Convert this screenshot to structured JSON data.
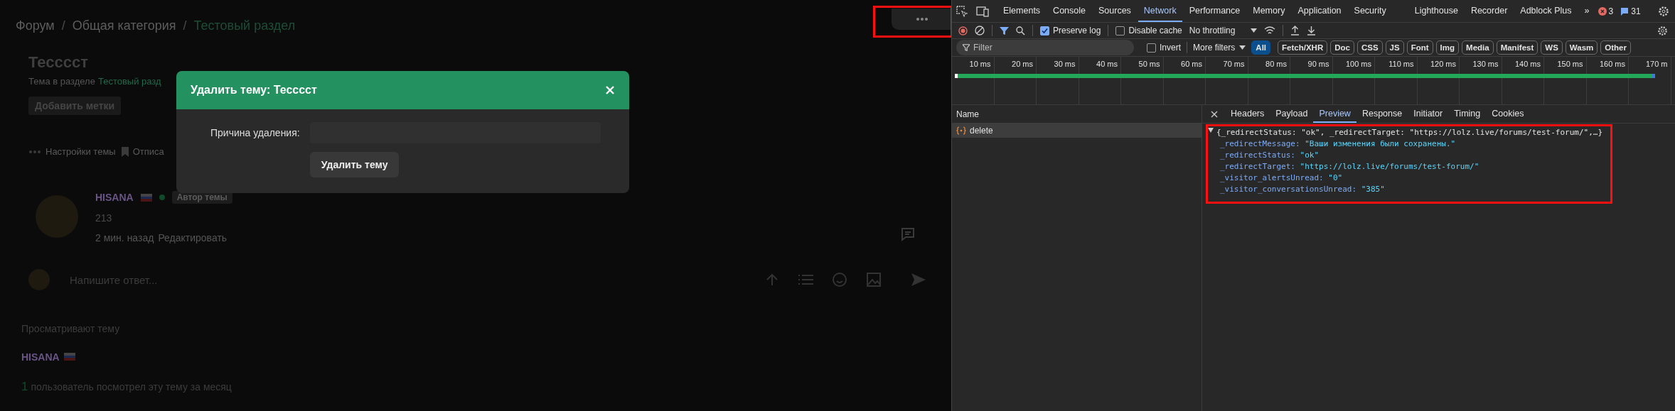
{
  "forum": {
    "breadcrumb_separator": "/",
    "breadcrumb": [
      {
        "label": "Форум",
        "current": false
      },
      {
        "label": "Общая категория",
        "current": false
      },
      {
        "label": "Тестовый раздел",
        "current": true
      }
    ],
    "thread_title": "Тесссст",
    "thread_subtitle": {
      "prefix": "Тема в разделе",
      "link": "Тестовый разд"
    },
    "add_tags_button": "Добавить метки",
    "thread_actions": [
      "Настройки темы",
      "Отписа"
    ],
    "post": {
      "author": "HISANA",
      "online": true,
      "badge": "Автор темы",
      "text": "213",
      "time": "2 мин. назад",
      "edit_link": "Редактировать"
    },
    "reply_placeholder": "Напишите ответ...",
    "viewers": {
      "title": "Просматривают тему",
      "users": [
        "HISANA"
      ],
      "count": "1",
      "count_text": "пользователь посмотрел эту тему за месяц"
    }
  },
  "modal": {
    "title": "Удалить тему: Тесссст",
    "reason_label": "Причина удаления:",
    "submit_button": "Удалить тему"
  },
  "devtools": {
    "tabs": [
      {
        "label": "Elements",
        "selected": false
      },
      {
        "label": "Console",
        "selected": false
      },
      {
        "label": "Sources",
        "selected": false
      },
      {
        "label": "Network",
        "selected": true
      },
      {
        "label": "Performance",
        "selected": false
      },
      {
        "label": "Memory",
        "selected": false
      },
      {
        "label": "Application",
        "selected": false
      },
      {
        "label": "Security",
        "selected": false
      },
      {
        "label": "Lighthouse",
        "selected": false
      },
      {
        "label": "Recorder",
        "selected": false
      },
      {
        "label": "Adblock Plus",
        "selected": false
      }
    ],
    "more_tabs": "»",
    "error_count": "3",
    "message_count": "31",
    "preserve_log": {
      "label": "Preserve log",
      "checked": true
    },
    "disable_cache": {
      "label": "Disable cache",
      "checked": false
    },
    "throttling": "No throttling",
    "filter": {
      "placeholder": "Filter"
    },
    "invert": {
      "label": "Invert",
      "checked": false
    },
    "more_filters": "More filters",
    "type_filters": [
      {
        "label": "All",
        "selected": true
      },
      {
        "label": "Fetch/XHR",
        "selected": false
      },
      {
        "label": "Doc",
        "selected": false
      },
      {
        "label": "CSS",
        "selected": false
      },
      {
        "label": "JS",
        "selected": false
      },
      {
        "label": "Font",
        "selected": false
      },
      {
        "label": "Img",
        "selected": false
      },
      {
        "label": "Media",
        "selected": false
      },
      {
        "label": "Manifest",
        "selected": false
      },
      {
        "label": "WS",
        "selected": false
      },
      {
        "label": "Wasm",
        "selected": false
      },
      {
        "label": "Other",
        "selected": false
      }
    ],
    "timeline_ticks": [
      "10 ms",
      "20 ms",
      "30 ms",
      "40 ms",
      "50 ms",
      "60 ms",
      "70 ms",
      "80 ms",
      "90 ms",
      "100 ms",
      "110 ms",
      "120 ms",
      "130 ms",
      "140 ms",
      "150 ms",
      "160 ms",
      "170 m"
    ],
    "name_header": "Name",
    "requests": [
      {
        "name": "delete",
        "selected": true
      }
    ],
    "detail_tabs": [
      {
        "label": "Headers",
        "selected": false
      },
      {
        "label": "Payload",
        "selected": false
      },
      {
        "label": "Preview",
        "selected": true
      },
      {
        "label": "Response",
        "selected": false
      },
      {
        "label": "Initiator",
        "selected": false
      },
      {
        "label": "Timing",
        "selected": false
      },
      {
        "label": "Cookies",
        "selected": false
      }
    ],
    "preview": {
      "summary": "{_redirectStatus: \"ok\", _redirectTarget: \"https://lolz.live/forums/test-forum/\",…}",
      "fields": [
        {
          "key": "_redirectMessage:",
          "value": "\"Ваши изменения были сохранены.\""
        },
        {
          "key": "_redirectStatus:",
          "value": "\"ok\""
        },
        {
          "key": "_redirectTarget:",
          "value": "\"https://lolz.live/forums/test-forum/\""
        },
        {
          "key": "_visitor_alertsUnread:",
          "value": "\"0\""
        },
        {
          "key": "_visitor_conversationsUnread:",
          "value": "\"385\""
        }
      ]
    }
  }
}
